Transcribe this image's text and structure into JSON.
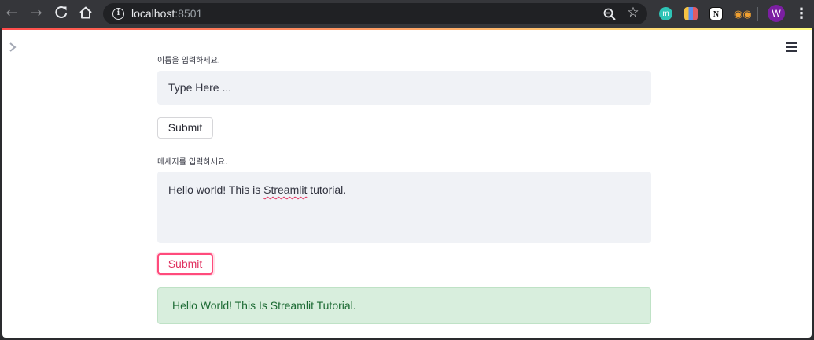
{
  "browser": {
    "url_host": "localhost",
    "url_port": ":8501",
    "profile_initial": "W",
    "extension_m_label": "m",
    "extension_notion_label": "N",
    "icons": [
      "back-icon",
      "forward-icon",
      "reload-icon",
      "home-icon",
      "info-icon",
      "zoom-icon",
      "star-icon",
      "more-icon"
    ]
  },
  "app": {
    "accent_color": "#ff4b7c",
    "name_label": "이름을 입력하세요.",
    "name_placeholder": "Type Here ...",
    "submit1_label": "Submit",
    "message_label": "메세지를 입력하세요.",
    "message_value_before": "Hello world! This is ",
    "message_value_misspelled": "Streamlit",
    "message_value_after": " tutorial.",
    "submit2_label": "Submit",
    "success_message": "Hello World! This Is Streamlit Tutorial.",
    "success_color": "#1d6b34"
  }
}
